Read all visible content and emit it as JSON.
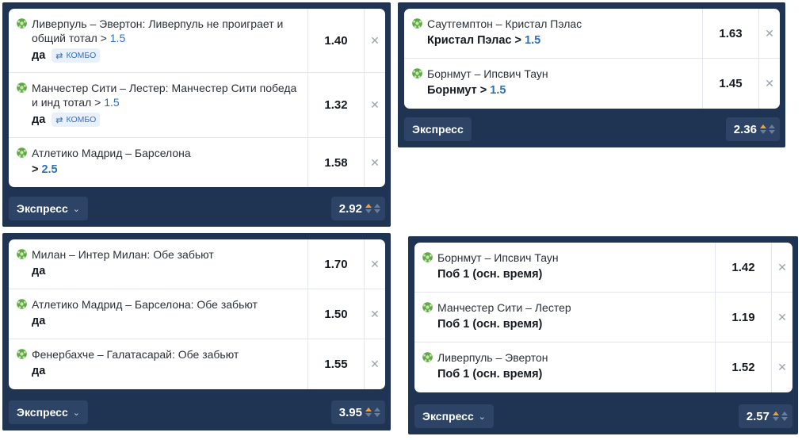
{
  "colors": {
    "panel": "#1f3352",
    "footer_button": "#2d4467",
    "accent_number": "#2f6fbf",
    "arrow_up": "#f0a030"
  },
  "coupons": [
    {
      "bets": [
        {
          "title": "Ливерпуль – Эвертон: Ливерпуль не проиграет и общий тотал > ",
          "title_num": "1.5",
          "sel": "да",
          "sel_num": "",
          "combo": "КОМБО",
          "odds": "1.40"
        },
        {
          "title": "Манчестер Сити – Лестер: Манчестер Сити победа и инд тотал > ",
          "title_num": "1.5",
          "sel": "да",
          "sel_num": "",
          "combo": "КОМБО",
          "odds": "1.32"
        },
        {
          "title": "Атлетико Мадрид – Барселона",
          "title_num": "",
          "sel": ">",
          "sel_num": "2.5",
          "combo": "",
          "odds": "1.58"
        }
      ],
      "type_label": "Экспресс",
      "total": "2.92"
    },
    {
      "bets": [
        {
          "title": "Саутгемптон – Кристал Пэлас",
          "sel": "Кристал Пэлас >",
          "sel_num": "1.5",
          "odds": "1.63"
        },
        {
          "title": "Борнмут – Ипсвич Таун",
          "sel": "Борнмут >",
          "sel_num": "1.5",
          "odds": "1.45"
        }
      ],
      "type_label": "Экспресс",
      "total": "2.36"
    },
    {
      "bets": [
        {
          "title": "Милан – Интер Милан: Обе забьют",
          "sel": "да",
          "odds": "1.70"
        },
        {
          "title": "Атлетико Мадрид – Барселона: Обе забьют",
          "sel": "да",
          "odds": "1.50"
        },
        {
          "title": "Фенербахче – Галатасарай: Обе забьют",
          "sel": "да",
          "odds": "1.55"
        }
      ],
      "type_label": "Экспресс",
      "total": "3.95"
    },
    {
      "bets": [
        {
          "title": "Борнмут – Ипсвич Таун",
          "sel": "Поб 1 (осн. время)",
          "odds": "1.42"
        },
        {
          "title": "Манчестер Сити – Лестер",
          "sel": "Поб 1 (осн. время)",
          "odds": "1.19"
        },
        {
          "title": "Ливерпуль – Эвертон",
          "sel": "Поб 1 (осн. время)",
          "odds": "1.52"
        }
      ],
      "type_label": "Экспресс",
      "total": "2.57"
    }
  ]
}
